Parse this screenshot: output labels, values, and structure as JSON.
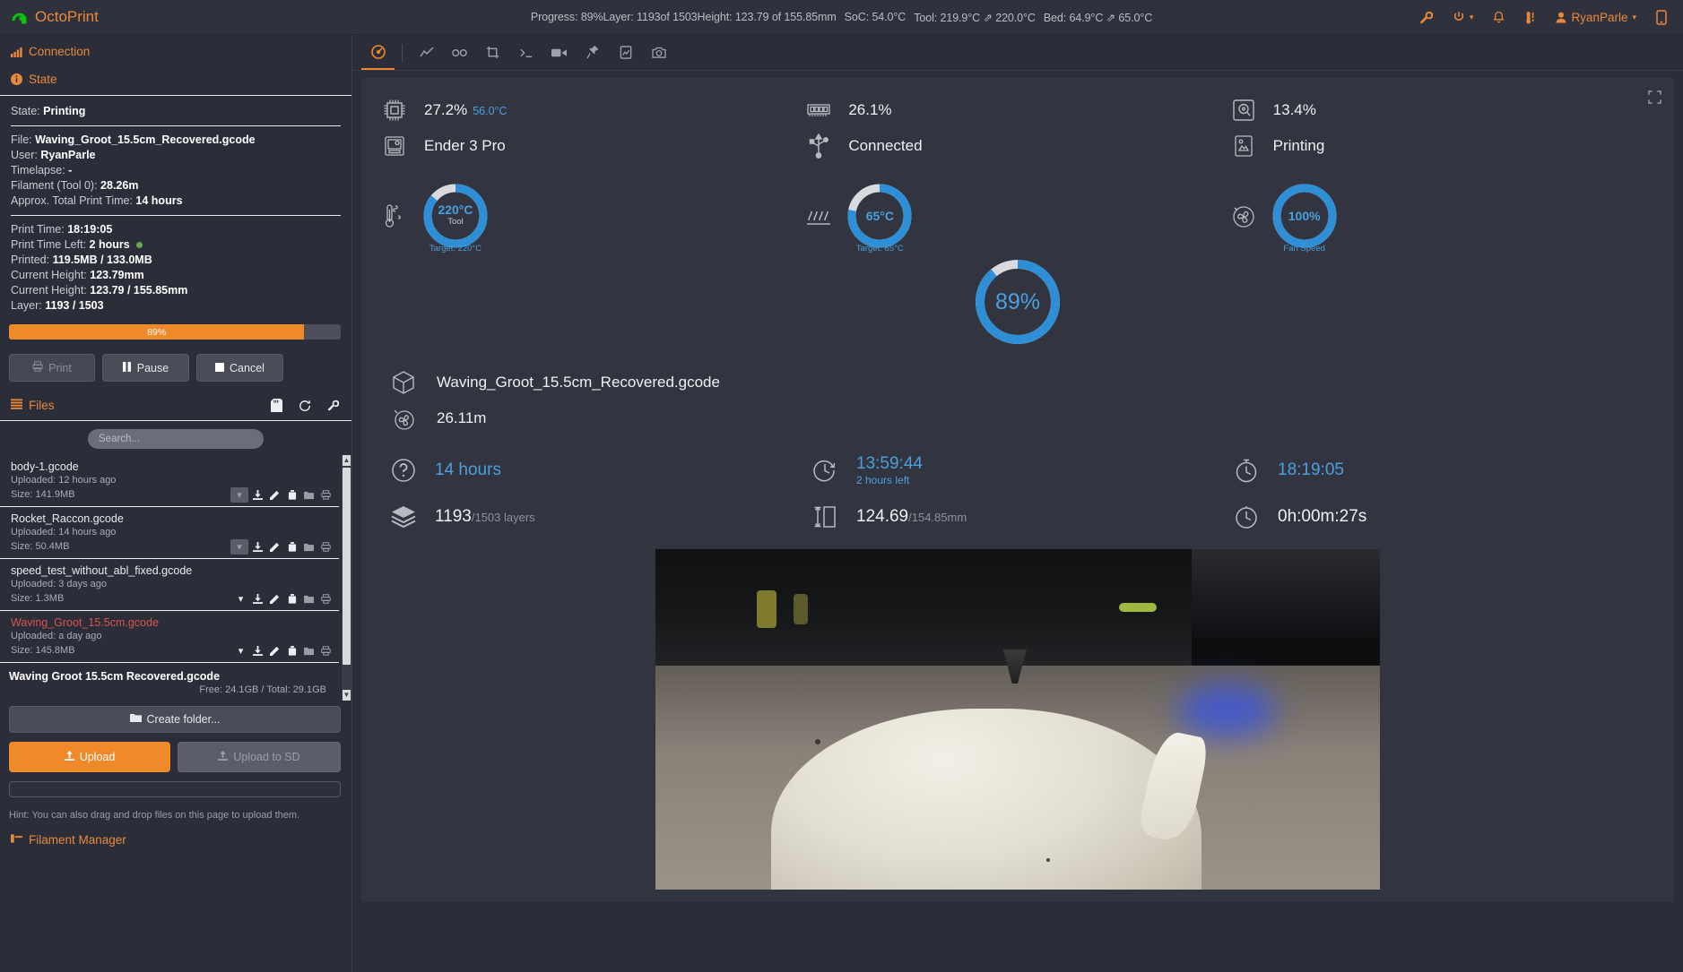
{
  "navbar": {
    "brand": "OctoPrint",
    "status_items": [
      "Progress: 89%",
      "Layer: 1193of 1503",
      "Height: 123.79 of 155.85mm",
      "SoC: 54.0°C",
      "Tool: 219.9°C ⇗ 220.0°C",
      "Bed: 64.9°C ⇗ 65.0°C"
    ],
    "icons": [
      "wrench-icon",
      "power-icon",
      "bell-icon",
      "thermometer-icon"
    ],
    "user": "RyanParle",
    "mobile_icon": "mobile-icon"
  },
  "sidebar": {
    "connection_title": "Connection",
    "state_title": "State",
    "state": {
      "state_label": "State:",
      "state_value": "Printing",
      "file_label": "File:",
      "file_value": "Waving_Groot_15.5cm_Recovered.gcode",
      "user_label": "User:",
      "user_value": "RyanParle",
      "timelapse_label": "Timelapse:",
      "timelapse_value": "-",
      "filament_label": "Filament (Tool 0):",
      "filament_value": "28.26m",
      "approx_label": "Approx. Total Print Time:",
      "approx_value": "14 hours",
      "print_time_label": "Print Time:",
      "print_time_value": "18:19:05",
      "print_time_left_label": "Print Time Left:",
      "print_time_left_value": "2 hours",
      "printed_label": "Printed:",
      "printed_value": "119.5MB / 133.0MB",
      "height_label": "Current Height:",
      "height_value": "123.79mm",
      "height2_label": "Current Height:",
      "height2_value": "123.79 / 155.85mm",
      "layer_label": "Layer:",
      "layer_value": "1193 / 1503"
    },
    "progress": {
      "percent": 89,
      "label": "89%"
    },
    "buttons": {
      "print": "Print",
      "pause": "Pause",
      "cancel": "Cancel"
    },
    "files_title": "Files",
    "search_placeholder": "Search...",
    "search_value": "",
    "files": [
      {
        "name": "body-1.gcode",
        "uploaded": "Uploaded: 12 hours ago",
        "size": "Size: 141.9MB",
        "active": false
      },
      {
        "name": "Rocket_Raccon.gcode",
        "uploaded": "Uploaded: 14 hours ago",
        "size": "Size: 50.4MB",
        "active": false
      },
      {
        "name": "speed_test_without_abl_fixed.gcode",
        "uploaded": "Uploaded: 3 days ago",
        "size": "Size: 1.3MB",
        "active": false
      },
      {
        "name": "Waving_Groot_15.5cm.gcode",
        "uploaded": "Uploaded: a day ago",
        "size": "Size: 145.8MB",
        "active": true
      }
    ],
    "selected_file": "Waving  Groot  15.5cm  Recovered.gcode",
    "free_space": "Free: 24.1GB / Total: 29.1GB",
    "create_folder": "Create folder...",
    "upload": "Upload",
    "upload_sd": "Upload to SD",
    "hint": "Hint: You can also drag and drop files on this page to upload them.",
    "filament_manager": "Filament Manager"
  },
  "tabs": [
    {
      "name": "dashboard",
      "icon": "dashboard-icon",
      "active": true
    },
    {
      "name": "temperature",
      "icon": "chart-line-icon",
      "active": false
    },
    {
      "name": "control",
      "icon": "link-icon",
      "active": false
    },
    {
      "name": "gcode-viewer",
      "icon": "crop-icon",
      "active": false
    },
    {
      "name": "terminal",
      "icon": "terminal-icon",
      "active": false
    },
    {
      "name": "timelapse",
      "icon": "video-icon",
      "active": false
    },
    {
      "name": "bedlevel",
      "icon": "pin-icon",
      "active": false
    },
    {
      "name": "plugin",
      "icon": "file-image-icon",
      "active": false
    },
    {
      "name": "webcam",
      "icon": "camera-icon",
      "active": false
    }
  ],
  "dashboard": {
    "stats": [
      {
        "icon": "cpu-icon",
        "value": "27.2%",
        "sub": "56.0°C"
      },
      {
        "icon": "memory-icon",
        "value": "26.1%",
        "sub": ""
      },
      {
        "icon": "disk-icon",
        "value": "13.4%",
        "sub": ""
      }
    ],
    "stats_row2": [
      {
        "icon": "printer-icon",
        "value": "Ender 3 Pro"
      },
      {
        "icon": "usb-icon",
        "value": "Connected"
      },
      {
        "icon": "job-icon",
        "value": "Printing"
      }
    ],
    "gauges": [
      {
        "icon": "thermometer-tool-icon",
        "main": "220°C",
        "sub": "Tool",
        "foot": "Target: 220°C",
        "percent": 86,
        "color": "#2f8fd6"
      },
      {
        "icon": "bed-heat-icon",
        "main": "65°C",
        "sub": "",
        "foot": "Target: 65°C",
        "percent": 78,
        "color": "#2f8fd6"
      },
      {
        "icon": "fan-icon",
        "main": "100%",
        "sub": "",
        "foot": "Fan Speed",
        "percent": 100,
        "color": "#2f8fd6"
      }
    ],
    "big_gauge": {
      "label": "89%",
      "percent": 89,
      "color": "#2f8fd6"
    },
    "job_file": {
      "icon": "cube-icon",
      "value": "Waving_Groot_15.5cm_Recovered.gcode"
    },
    "job_filament": {
      "icon": "filament-icon",
      "value": "26.11m"
    },
    "info": [
      {
        "icon": "question-icon",
        "main": "14 hours",
        "sub": "",
        "main_color": "blue"
      },
      {
        "icon": "clock-arrow-icon",
        "main": "13:59:44",
        "sub": "2 hours left",
        "main_color": "blue"
      },
      {
        "icon": "stopwatch-icon",
        "main": "18:19:05",
        "sub": "",
        "main_color": "blue"
      },
      {
        "icon": "layers-icon",
        "main": "1193",
        "sub": "/1503 layers",
        "main_color": "white"
      },
      {
        "icon": "height-icon",
        "main": "124.69",
        "sub": "/154.85mm",
        "main_color": "white"
      },
      {
        "icon": "timer-icon",
        "main": "0h:00m:27s",
        "sub": "",
        "main_color": "white"
      }
    ],
    "expand_icon": "expand-icon"
  },
  "colors": {
    "accent": "#f0892a",
    "blue": "#4a9fe0",
    "gauge": "#2f8fd6",
    "bg": "#2b2e39",
    "panel": "#32353f",
    "danger": "#d9534f"
  }
}
